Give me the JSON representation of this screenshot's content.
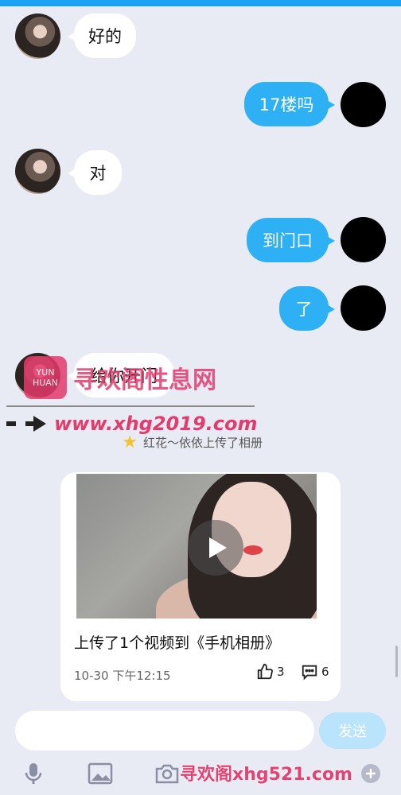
{
  "messages": [
    {
      "side": "in",
      "text": "好的"
    },
    {
      "side": "out",
      "text": "17楼吗"
    },
    {
      "side": "in",
      "text": "对"
    },
    {
      "side": "out",
      "text": "到门口"
    },
    {
      "side": "out",
      "text": "了"
    },
    {
      "side": "in",
      "text": "给你开门"
    }
  ],
  "notice": {
    "text": "红花～依依上传了相册"
  },
  "watermark": {
    "logo_text": "YUN HUAN",
    "site_name": "寻欢阁性息网",
    "url": "www.xhg2019.com",
    "bottom_url": "寻欢阁xhg521.com"
  },
  "card": {
    "title": "上传了1个视频到《手机相册》",
    "time": "10-30 下午12:15",
    "likes": "3",
    "comments": "6"
  },
  "input": {
    "placeholder": "",
    "send_label": "发送"
  },
  "toolbar": {
    "icons": [
      "microphone-icon",
      "image-icon",
      "camera-icon",
      "plus-icon"
    ]
  },
  "colors": {
    "accent": "#2eb0f5",
    "background": "#e9ebf4",
    "watermark": "#e43a6c"
  }
}
